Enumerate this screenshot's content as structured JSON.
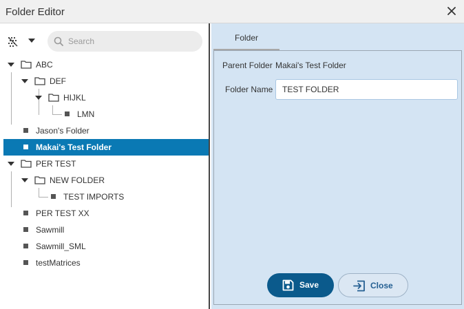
{
  "window": {
    "title": "Folder Editor"
  },
  "search": {
    "placeholder": "Search"
  },
  "tree": {
    "nodes": [
      {
        "label": "ABC"
      },
      {
        "label": "DEF"
      },
      {
        "label": "HIJKL"
      },
      {
        "label": "LMN"
      },
      {
        "label": "Jason's Folder"
      },
      {
        "label": "Makai's Test Folder",
        "selected": true
      },
      {
        "label": "PER TEST"
      },
      {
        "label": "NEW FOLDER"
      },
      {
        "label": "TEST IMPORTS"
      },
      {
        "label": "PER TEST XX"
      },
      {
        "label": "Sawmill"
      },
      {
        "label": "Sawmill_SML"
      },
      {
        "label": "testMatrices"
      }
    ]
  },
  "tabs": [
    {
      "label": "Folder",
      "active": true
    }
  ],
  "form": {
    "parent_label": "Parent Folder",
    "parent_value": "Makai's Test Folder",
    "name_label": "Folder Name",
    "name_value": "TEST FOLDER"
  },
  "buttons": {
    "save": "Save",
    "close": "Close"
  },
  "colors": {
    "selected": "#0a79b4",
    "save_bg": "#0b5a8c",
    "panel_bg": "#d4e4f3"
  },
  "icons": {
    "toolbar": [
      "select-pattern-icon",
      "caret-down-icon"
    ],
    "search": "search-icon",
    "window_close": "close-icon",
    "save": "floppy-disk-icon",
    "close": "exit-icon"
  }
}
